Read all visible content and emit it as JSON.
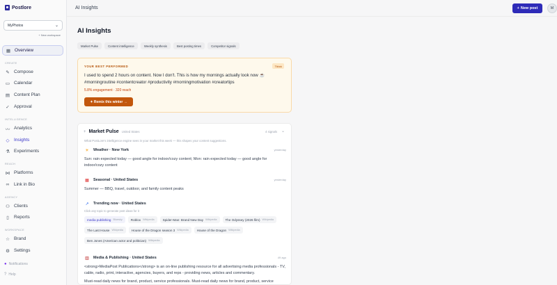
{
  "brand": {
    "name": "Postlore"
  },
  "workspace": {
    "selected": "MyPhotos",
    "new_label": "+ New workspace"
  },
  "nav": {
    "overview": "Overview",
    "create_label": "CREATE",
    "compose": "Compose",
    "calendar": "Calendar",
    "content_plan": "Content Plan",
    "approval": "Approval",
    "intelligence_label": "INTELLIGENCE",
    "analytics": "Analytics",
    "insights": "Insights",
    "experiments": "Experiments",
    "reach_label": "REACH",
    "platforms": "Platforms",
    "link_in_bio": "Link in Bio",
    "agency_label": "AGENCY",
    "clients": "Clients",
    "reports": "Reports",
    "workspace_label": "WORKSPACE",
    "brand": "Brand",
    "settings": "Settings",
    "notifications": "Notifications",
    "help": "Help"
  },
  "topbar": {
    "title": "AI Insights",
    "new_post": "New post",
    "avatar": "M"
  },
  "page": {
    "title": "AI Insights"
  },
  "tabs": [
    "Market Pulse",
    "Content intelligence",
    "Weekly synthesis",
    "Best posting times",
    "Competitor signals"
  ],
  "best": {
    "label": "YOUR BEST PERFORMED",
    "badge": "Tiktok",
    "text": "I used to spend 2 hours on content. Now I don't. This is how my mornings actually look now ☕ #morningroutine #contentcreator #productivity #morningmotivation #creatortips",
    "stats": "5.8% engagement · 320 reach",
    "remix": "✦ Remix this winter →"
  },
  "pulse": {
    "title": "Market Pulse",
    "region": "United States",
    "count": "4 signals",
    "desc": "What PostLore's intelligence engine sees in your market this week — this shapes your content suggestions.",
    "weather": {
      "title": "Weather · New York",
      "time": "yesterday",
      "body": "Sun: rain expected today — good angle for indoor/cozy content; Mon: rain expected today — good angle for indoor/cozy content"
    },
    "seasonal": {
      "title": "Seasonal · United States",
      "time": "yesterday",
      "body": "Summer — BBQ, travel, outdoor, and family content peaks"
    },
    "trending": {
      "title": "Trending now · United States",
      "sub": "Click any topic to generate post ideas for it",
      "chips": [
        {
          "label": "media publishing",
          "src": "Bluesky"
        },
        {
          "label": "Roblox",
          "src": "Wikipedia"
        },
        {
          "label": "Spider-Man: Brand New Day",
          "src": "Wikipedia"
        },
        {
          "label": "The Odyssey (2026 film)",
          "src": "Wikipedia"
        },
        {
          "label": "The Last House",
          "src": "Wikipedia"
        },
        {
          "label": "House of the Dragon season 3",
          "src": "Wikipedia"
        },
        {
          "label": "House of the Dragon",
          "src": "Wikipedia"
        },
        {
          "label": "Ben Jones (American actor and politician)",
          "src": "Wikipedia"
        }
      ]
    },
    "media": {
      "title": "Media & Publishing · United States",
      "time": "49 ago",
      "body": "<strong>MediaPost Publications</strong> is an on-line publishing resource for all advertising media professionals - TV, cable, radio, print, interactive, agencies, buyers, and reps - providing news, articles and commentary.",
      "body2": "Must-read daily news for brand, product, service professionals. Must-read daily news for brand, product, service"
    }
  }
}
